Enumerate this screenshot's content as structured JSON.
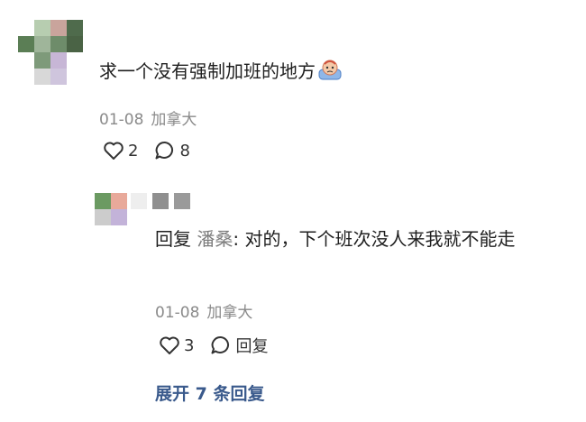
{
  "comment": {
    "text": "求一个没有强制加班的地方",
    "date": "01-08",
    "location": "加拿大",
    "likes": "2",
    "replies": "8",
    "avatar_colors": [
      "#ffffff",
      "#b7cdb0",
      "#c9a49c",
      "#4f6b4c",
      "#5b7e55",
      "#9fb59a",
      "#6e8c6a",
      "#4a6345",
      "#ffffff",
      "#7e9a7a",
      "#c7b6d6",
      "#ffffff",
      "#ffffff",
      "#d8d8d8",
      "#cfc5dd",
      "#ffffff"
    ]
  },
  "reply": {
    "prefix": "回复",
    "reply_to_user": "潘桑",
    "text": ": 对的，下个班次没人来我就不能走",
    "date": "01-08",
    "location": "加拿大",
    "likes": "3",
    "reply_label": "回复",
    "avatar_colors": [
      "#6b9a62",
      "#e8a99a",
      "#cccccc",
      "#c3b3d9"
    ],
    "name_colors": [
      "#eeeeee",
      "#8f8f8f",
      "#9a9a9a"
    ]
  },
  "expand_label": "展开 7 条回复"
}
